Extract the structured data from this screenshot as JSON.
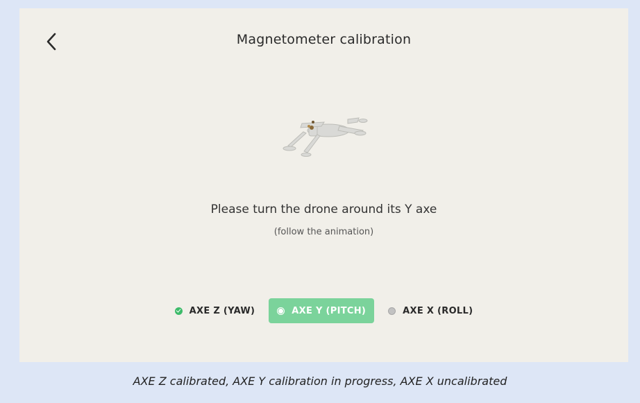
{
  "header": {
    "title": "Magnetometer calibration",
    "back_icon": "chevron-left-icon"
  },
  "instruction": {
    "main": "Please turn the drone around its Y axe",
    "hint": "(follow the animation)"
  },
  "axes": [
    {
      "label": "AXE Z (YAW)",
      "status": "calibrated",
      "icon": "check-circle-icon"
    },
    {
      "label": "AXE Y (PITCH)",
      "status": "in progress",
      "icon": "circle-outline-icon"
    },
    {
      "label": "AXE X (ROLL)",
      "status": "uncalibrated",
      "icon": "circle-grey-icon"
    }
  ],
  "caption": "AXE Z calibrated, AXE Y calibration in progress, AXE X uncalibrated",
  "colors": {
    "page_background": "#dde6f6",
    "screen_background": "#f1efe9",
    "calibrated": "#3dbb6a",
    "active_chip": "#7bd39b",
    "uncalibrated": "#c2c2c2"
  }
}
